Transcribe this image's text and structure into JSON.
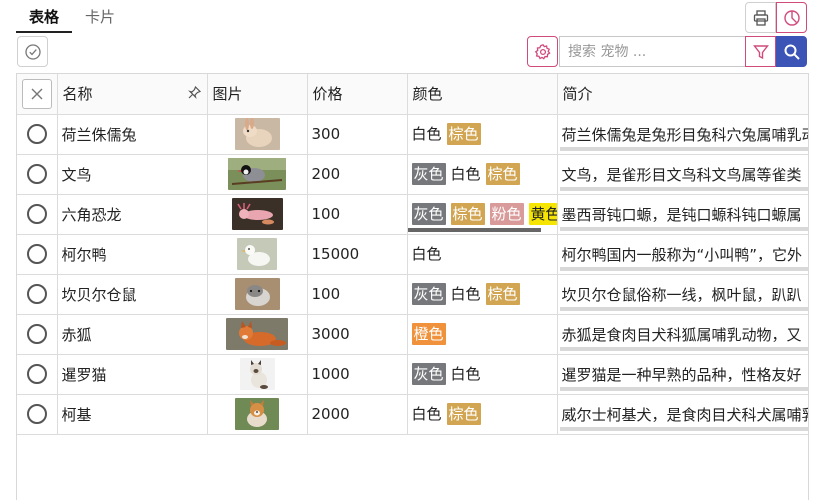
{
  "tabs": [
    {
      "label": "表格",
      "active": true
    },
    {
      "label": "卡片",
      "active": false
    }
  ],
  "search": {
    "placeholder": "搜索 宠物 ...",
    "value": ""
  },
  "columns": {
    "name": "名称",
    "image": "图片",
    "price": "价格",
    "color": "颜色",
    "desc": "简介"
  },
  "colors": {
    "灰色": {
      "bg": "#76787c",
      "fg": "#ffffff"
    },
    "白色": {
      "bg": "#ffffff",
      "fg": "#222222"
    },
    "棕色": {
      "bg": "#d2a552",
      "fg": "#ffffff"
    },
    "粉色": {
      "bg": "#d99a9a",
      "fg": "#ffffff"
    },
    "黄色": {
      "bg": "#f5e500",
      "fg": "#222222"
    },
    "橙色": {
      "bg": "#f0923c",
      "fg": "#ffffff"
    }
  },
  "accent": "#d04a7c",
  "search_button_color": "#3b54b6",
  "rows": [
    {
      "name": "荷兰侏儒兔",
      "image_icon": "rabbit-photo",
      "price": "300",
      "tags": [
        "白色",
        "棕色"
      ],
      "desc": "荷兰侏儒兔是兔形目兔科穴兔属哺乳动物",
      "progress": 0.46
    },
    {
      "name": "文鸟",
      "image_icon": "bird-photo",
      "price": "200",
      "tags": [
        "灰色",
        "白色",
        "棕色"
      ],
      "desc": "文鸟，是雀形目文鸟科文鸟属等雀类",
      "progress": 0.41
    },
    {
      "name": "六角恐龙",
      "image_icon": "axolotl-photo",
      "price": "100",
      "tags": [
        "灰色",
        "棕色",
        "粉色",
        "黄色"
      ],
      "desc": "墨西哥钝口螈，是钝口螈科钝口螈属",
      "progress": 0.45
    },
    {
      "name": "柯尔鸭",
      "image_icon": "duck-photo",
      "price": "15000",
      "tags": [
        "白色"
      ],
      "desc": "柯尔鸭国内一般称为“小叫鸭”，它外",
      "progress": 0.73
    },
    {
      "name": "坎贝尔仓鼠",
      "image_icon": "hamster-photo",
      "price": "100",
      "tags": [
        "灰色",
        "白色",
        "棕色"
      ],
      "desc": "坎贝尔仓鼠俗称一线，枫叶鼠，趴趴",
      "progress": 0.55
    },
    {
      "name": "赤狐",
      "image_icon": "fox-photo",
      "price": "3000",
      "tags": [
        "橙色"
      ],
      "desc": "赤狐是食肉目犬科狐属哺乳动物，又",
      "progress": 0.24
    },
    {
      "name": "暹罗猫",
      "image_icon": "cat-photo",
      "price": "1000",
      "tags": [
        "灰色",
        "白色"
      ],
      "desc": "暹罗猫是一种早熟的品种，性格友好",
      "progress": 0.82
    },
    {
      "name": "柯基",
      "image_icon": "corgi-photo",
      "price": "2000",
      "tags": [
        "白色",
        "棕色"
      ],
      "desc": "威尔士柯基犬，是食肉目犬科犬属哺乳动物",
      "progress": 0.35
    }
  ],
  "color_scroll": 0.95
}
